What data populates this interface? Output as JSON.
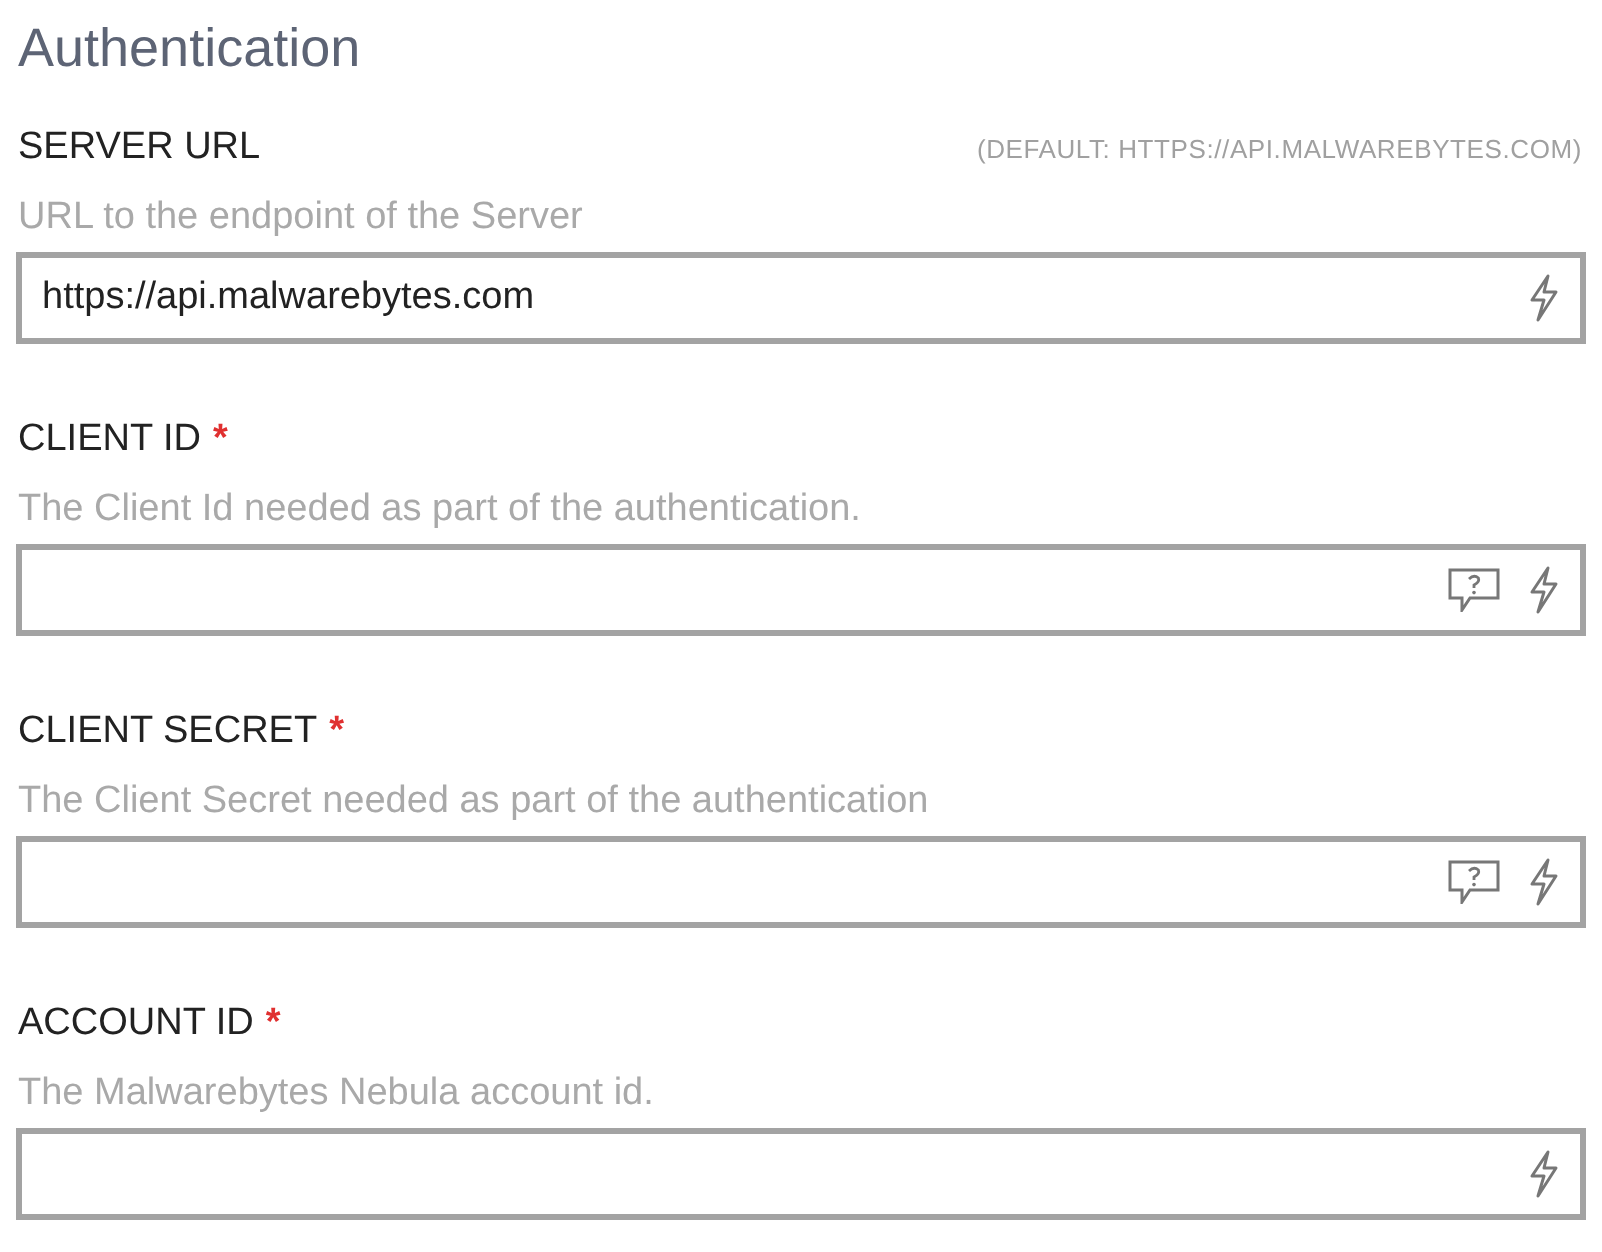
{
  "section": {
    "title": "Authentication"
  },
  "fields": [
    {
      "label": "SERVER URL",
      "default_hint": "(DEFAULT: HTTPS://API.MALWAREBYTES.COM)",
      "description": "URL to the endpoint of the Server",
      "value": "https://api.malwarebytes.com",
      "help": false
    },
    {
      "label": "CLIENT ID",
      "required_mark": "*",
      "description": "The Client Id needed as part of the authentication.",
      "help": true
    },
    {
      "label": "CLIENT SECRET",
      "required_mark": "*",
      "description": "The Client Secret needed as part of the authentication",
      "help": true
    },
    {
      "label": "ACCOUNT ID",
      "required_mark": "*",
      "description": "The Malwarebytes Nebula account id.",
      "help": false
    }
  ]
}
